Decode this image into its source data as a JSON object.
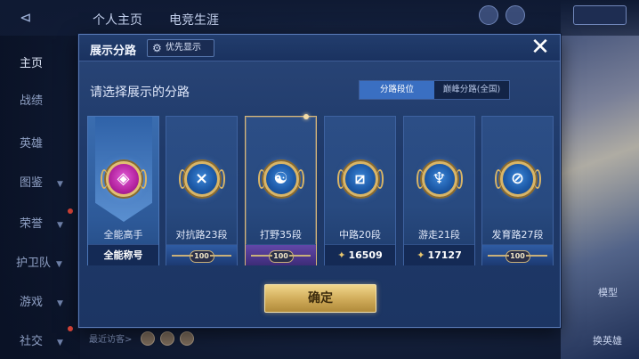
{
  "background": {
    "top_tabs": [
      "个人主页",
      "电竞生涯"
    ],
    "sidebar": [
      {
        "label": "主页",
        "chevron": false,
        "active": true
      },
      {
        "label": "战绩",
        "chevron": false,
        "active": false
      },
      {
        "label": "英雄",
        "chevron": false,
        "active": false
      },
      {
        "label": "图鉴",
        "chevron": true,
        "active": false
      },
      {
        "label": "荣誉",
        "chevron": true,
        "active": false
      },
      {
        "label": "护卫队",
        "chevron": true,
        "active": false
      },
      {
        "label": "游戏",
        "chevron": true,
        "active": false
      },
      {
        "label": "社交",
        "chevron": true,
        "active": false
      }
    ],
    "right_buttons": [
      "模型",
      "换英雄"
    ],
    "recent_visitors_label": "最近访客>"
  },
  "modal": {
    "title": "展示分路",
    "priority_label": "优先显示",
    "instruction": "请选择展示的分路",
    "toggle": {
      "options": [
        "分路段位",
        "巅峰分路(全国)"
      ],
      "selected_index": 0
    },
    "cards": [
      {
        "label": "全能高手",
        "footer": "全能称号",
        "footer_type": "text",
        "selected": false,
        "badge": "all-round"
      },
      {
        "label": "对抗路23段",
        "footer": "100",
        "footer_type": "tier",
        "selected": false,
        "badge": "clash-lane"
      },
      {
        "label": "打野35段",
        "footer": "100",
        "footer_type": "tier",
        "selected": true,
        "badge": "jungle"
      },
      {
        "label": "中路20段",
        "footer": "16509",
        "footer_type": "points",
        "selected": false,
        "badge": "mid-lane"
      },
      {
        "label": "游走21段",
        "footer": "17127",
        "footer_type": "points",
        "selected": false,
        "badge": "roam"
      },
      {
        "label": "发育路27段",
        "footer": "100",
        "footer_type": "tier",
        "selected": false,
        "badge": "farm-lane"
      }
    ],
    "confirm_label": "确定"
  },
  "colors": {
    "accent_gold": "#d9b566",
    "toggle_active": "#3a6fc2",
    "modal_bg": "#1f3a6a"
  }
}
